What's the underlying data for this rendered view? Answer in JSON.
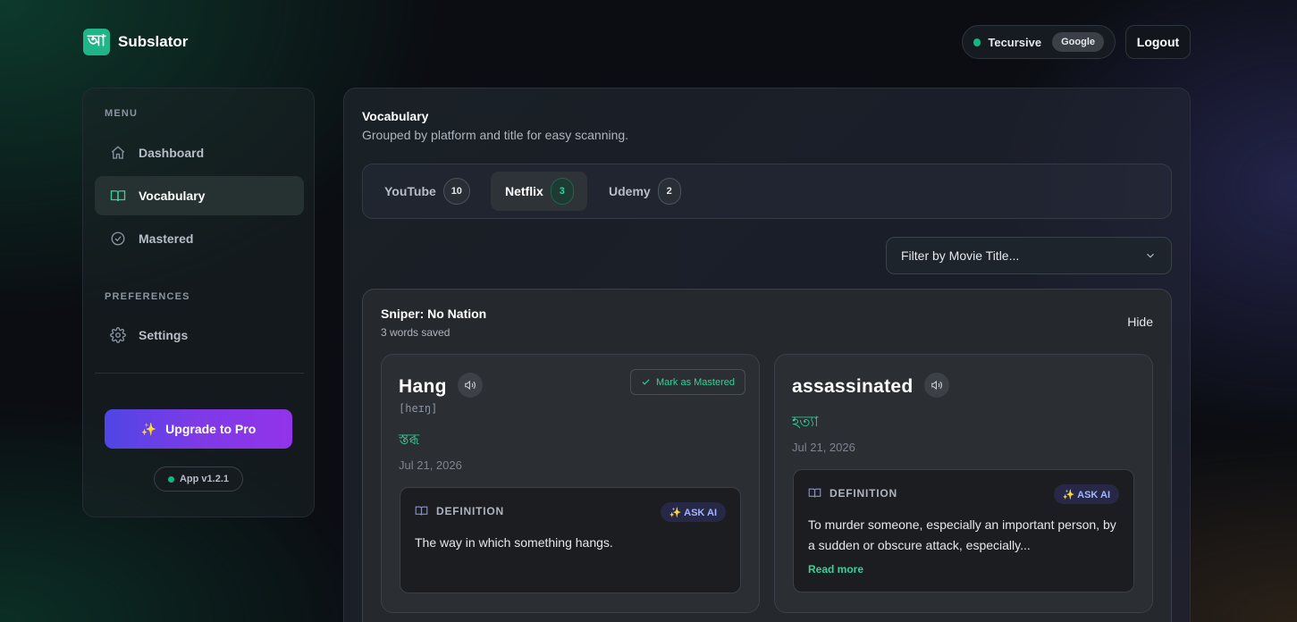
{
  "app": {
    "logo_glyph": "আ",
    "name": "Subslator"
  },
  "header": {
    "user_name": "Tecursive",
    "provider_badge": "Google",
    "logout_label": "Logout",
    "status_color": "#10b981"
  },
  "sidebar": {
    "menu_heading": "MENU",
    "items": [
      {
        "label": "Dashboard",
        "icon": "home-icon"
      },
      {
        "label": "Vocabulary",
        "icon": "book-icon",
        "active": true
      },
      {
        "label": "Mastered",
        "icon": "check-circle-icon"
      }
    ],
    "preferences_heading": "PREFERENCES",
    "settings_label": "Settings",
    "upgrade_label": "Upgrade to Pro",
    "upgrade_icon": "✨",
    "version": "App v1.2.1"
  },
  "page": {
    "title": "Vocabulary",
    "subtitle": "Grouped by platform and title for easy scanning."
  },
  "tabs": [
    {
      "label": "YouTube",
      "count": "10"
    },
    {
      "label": "Netflix",
      "count": "3",
      "active": true
    },
    {
      "label": "Udemy",
      "count": "2"
    }
  ],
  "filter": {
    "placeholder": "Filter by Movie Title..."
  },
  "group": {
    "title": "Sniper: No Nation",
    "subtitle": "3 words saved",
    "hide_label": "Hide",
    "cards": [
      {
        "word": "Hang",
        "ipa": "[heɪŋ]",
        "translation": "স্তব্ধ",
        "date": "Jul 21, 2026",
        "mastered_label": "Mark as Mastered",
        "definition_label": "DEFINITION",
        "ask_ai_label": "✨ ASK AI",
        "definition": "The way in which something hangs."
      },
      {
        "word": "assassinated",
        "translation": "হত্যা",
        "date": "Jul 21, 2026",
        "definition_label": "DEFINITION",
        "ask_ai_label": "✨ ASK AI",
        "definition": "To murder someone, especially an important person, by a sudden or obscure attack, especially...",
        "read_more_label": "Read more"
      }
    ]
  }
}
